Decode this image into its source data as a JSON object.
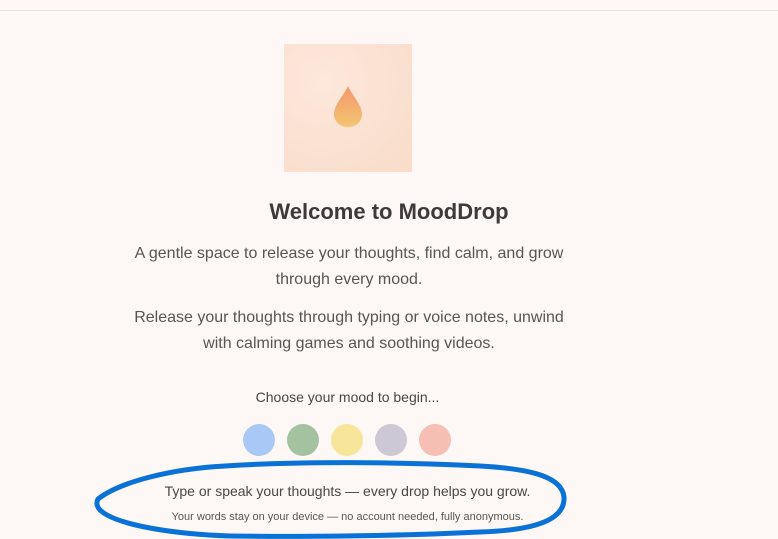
{
  "hero": {
    "icon": "drop-icon"
  },
  "welcome": {
    "title": "Welcome to MoodDrop",
    "tagline": "A gentle space to release your thoughts, find calm, and grow through every mood.",
    "description": "Release your thoughts through typing or voice notes, unwind with calming games and soothing videos."
  },
  "mood_picker": {
    "prompt": "Choose your mood to begin...",
    "colors": [
      "#a9c8f5",
      "#a4c1a0",
      "#f7e59a",
      "#ccc8d6",
      "#f5bfb3"
    ]
  },
  "footer": {
    "hint": "Type or speak your thoughts — every drop helps you grow.",
    "privacy": "Your words stay on your device — no account needed, fully anonymous."
  },
  "colors": {
    "background": "#fdf8f6",
    "annotation": "#0a72d6",
    "drop_top": "#f5a070",
    "drop_bottom": "#f3c16f"
  }
}
